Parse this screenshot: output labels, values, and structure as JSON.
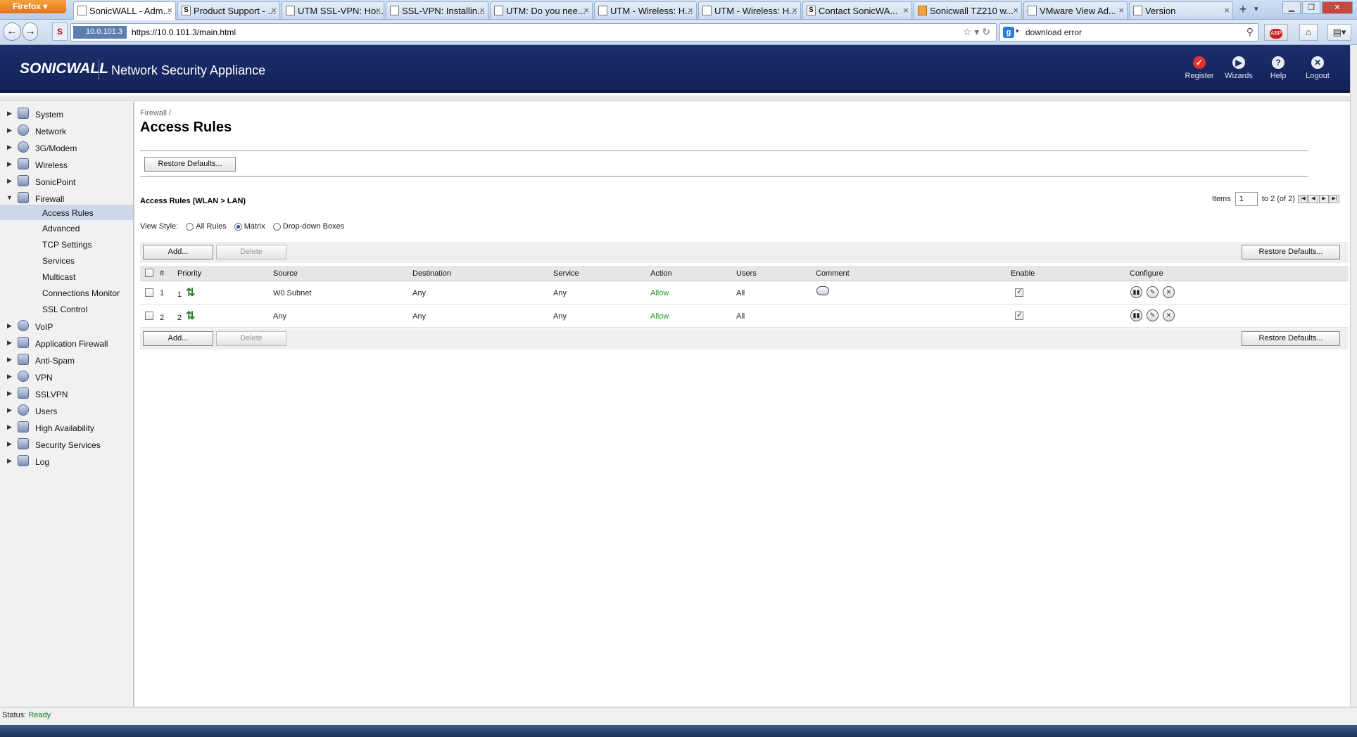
{
  "browser": {
    "app_button": "Firefox",
    "tabs": [
      {
        "title": "SonicWALL - Adm...",
        "active": true,
        "icon": "page-icon"
      },
      {
        "title": "Product Support - ...",
        "active": false,
        "icon": "sonicwall-s-icon"
      },
      {
        "title": "UTM SSL-VPN: Ho...",
        "active": false,
        "icon": "page-icon"
      },
      {
        "title": "SSL-VPN: Installin...",
        "active": false,
        "icon": "page-icon"
      },
      {
        "title": "UTM: Do you nee...",
        "active": false,
        "icon": "page-icon"
      },
      {
        "title": "UTM - Wireless: H...",
        "active": false,
        "icon": "page-icon"
      },
      {
        "title": "UTM - Wireless: H...",
        "active": false,
        "icon": "page-icon"
      },
      {
        "title": "Contact SonicWA...",
        "active": false,
        "icon": "sonicwall-s-icon"
      },
      {
        "title": "Sonicwall TZ210 w...",
        "active": false,
        "icon": "bookmark-icon"
      },
      {
        "title": "VMware View Ad...",
        "active": false,
        "icon": "page-icon"
      },
      {
        "title": "Version",
        "active": false,
        "icon": "page-icon"
      }
    ],
    "new_tab": "+",
    "url_identity": "10.0.101.3",
    "url": "https://10.0.101.3/main.html",
    "search_value": "download error"
  },
  "header": {
    "logo": "SONICWALL",
    "product": "Network Security Appliance",
    "actions": [
      {
        "label": "Register",
        "icon": "register-icon"
      },
      {
        "label": "Wizards",
        "icon": "wizards-icon"
      },
      {
        "label": "Help",
        "icon": "help-icon"
      },
      {
        "label": "Logout",
        "icon": "logout-icon"
      }
    ]
  },
  "sidebar": {
    "items": [
      {
        "label": "System",
        "expanded": false
      },
      {
        "label": "Network",
        "expanded": false
      },
      {
        "label": "3G/Modem",
        "expanded": false
      },
      {
        "label": "Wireless",
        "expanded": false
      },
      {
        "label": "SonicPoint",
        "expanded": false
      },
      {
        "label": "Firewall",
        "expanded": true
      }
    ],
    "firewall_sub": [
      {
        "label": "Access Rules",
        "selected": true
      },
      {
        "label": "Advanced",
        "selected": false
      },
      {
        "label": "TCP Settings",
        "selected": false
      },
      {
        "label": "Services",
        "selected": false
      },
      {
        "label": "Multicast",
        "selected": false
      },
      {
        "label": "Connections Monitor",
        "selected": false
      },
      {
        "label": "SSL Control",
        "selected": false
      }
    ],
    "items_after": [
      {
        "label": "VoIP"
      },
      {
        "label": "Application Firewall"
      },
      {
        "label": "Anti-Spam"
      },
      {
        "label": "VPN"
      },
      {
        "label": "SSLVPN"
      },
      {
        "label": "Users"
      },
      {
        "label": "High Availability"
      },
      {
        "label": "Security Services"
      },
      {
        "label": "Log"
      }
    ]
  },
  "main": {
    "breadcrumb": "Firewall /",
    "title": "Access Rules",
    "restore_defaults_top": "Restore Defaults...",
    "section_title": "Access Rules (WLAN > LAN)",
    "pager": {
      "label": "Items",
      "value": "1",
      "suffix": "to 2 (of 2)"
    },
    "view_style": {
      "label": "View Style:",
      "options": [
        "All Rules",
        "Matrix",
        "Drop-down Boxes"
      ],
      "selected": "Matrix"
    },
    "add_label": "Add...",
    "delete_label": "Delete",
    "restore_defaults": "Restore Defaults...",
    "columns": [
      "#",
      "Priority",
      "Source",
      "Destination",
      "Service",
      "Action",
      "Users",
      "Comment",
      "Enable",
      "Configure"
    ],
    "rows": [
      {
        "num": "1",
        "priority": "1",
        "source": "W0 Subnet",
        "destination": "Any",
        "service": "Any",
        "action": "Allow",
        "users": "All",
        "has_comment": true,
        "enabled": true
      },
      {
        "num": "2",
        "priority": "2",
        "source": "Any",
        "destination": "Any",
        "service": "Any",
        "action": "Allow",
        "users": "All",
        "has_comment": false,
        "enabled": true
      }
    ]
  },
  "status": {
    "label": "Status:",
    "value": "Ready"
  }
}
